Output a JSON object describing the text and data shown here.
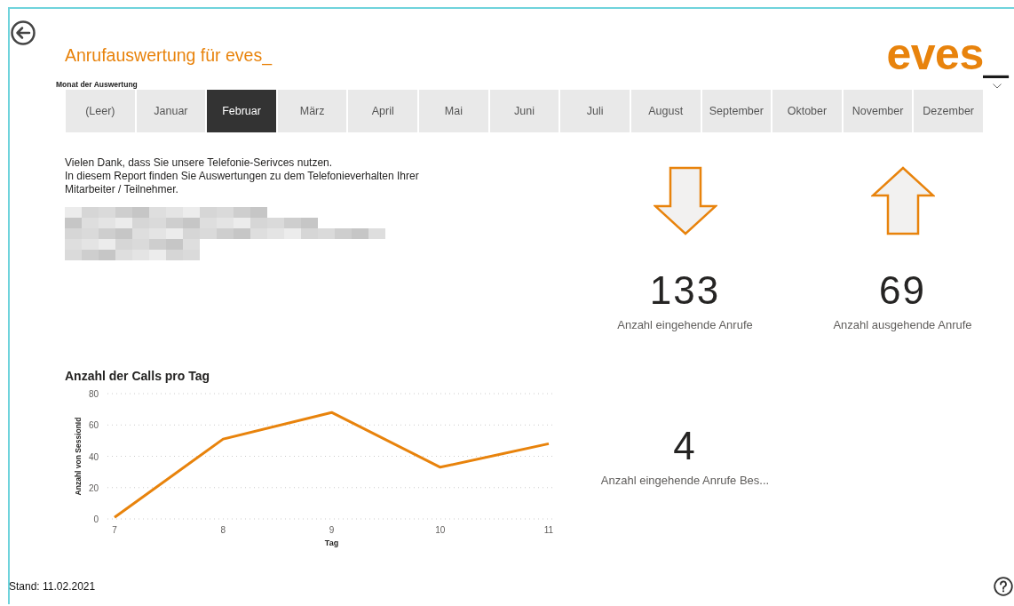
{
  "header": {
    "title": "Anrufauswertung für eves_",
    "logo": {
      "text": "eves",
      "suffix": "_"
    }
  },
  "slicer": {
    "label": "Monat der Auswertung",
    "items": [
      {
        "label": "(Leer)",
        "selected": false
      },
      {
        "label": "Januar",
        "selected": false
      },
      {
        "label": "Februar",
        "selected": true
      },
      {
        "label": "März",
        "selected": false
      },
      {
        "label": "April",
        "selected": false
      },
      {
        "label": "Mai",
        "selected": false
      },
      {
        "label": "Juni",
        "selected": false
      },
      {
        "label": "Juli",
        "selected": false
      },
      {
        "label": "August",
        "selected": false
      },
      {
        "label": "September",
        "selected": false
      },
      {
        "label": "Oktober",
        "selected": false
      },
      {
        "label": "November",
        "selected": false
      },
      {
        "label": "Dezember",
        "selected": false
      }
    ]
  },
  "intro": {
    "lines": [
      "Vielen Dank, dass Sie unsere Telefonie-Serivces nutzen.",
      "In diesem Report finden Sie Auswertungen zu dem Telefonieverhalten Ihrer Mitarbeiter / Teilnehmer."
    ]
  },
  "kpis": [
    {
      "kind": "down",
      "value": "133",
      "label": "Anzahl eingehende Anrufe"
    },
    {
      "kind": "up",
      "value": "69",
      "label": "Anzahl ausgehende Anrufe"
    },
    {
      "kind": "plain",
      "value": "4",
      "label": "Anzahl eingehende Anrufe Bes..."
    }
  ],
  "chart": {
    "chart_data": {
      "type": "line",
      "title": "Anzahl der Calls pro Tag",
      "xlabel": "Tag",
      "ylabel": "Anzahl von SessionId",
      "categories": [
        "7",
        "8",
        "9",
        "10",
        "11"
      ],
      "ylim": [
        0,
        80
      ],
      "yticks": [
        0,
        20,
        40,
        60,
        80
      ],
      "grid": true,
      "series": [
        {
          "color": "#e8830c",
          "values": [
            1,
            51,
            68,
            33,
            48
          ]
        }
      ]
    }
  },
  "footer": {
    "stand": "Stand: 11.02.2021"
  }
}
